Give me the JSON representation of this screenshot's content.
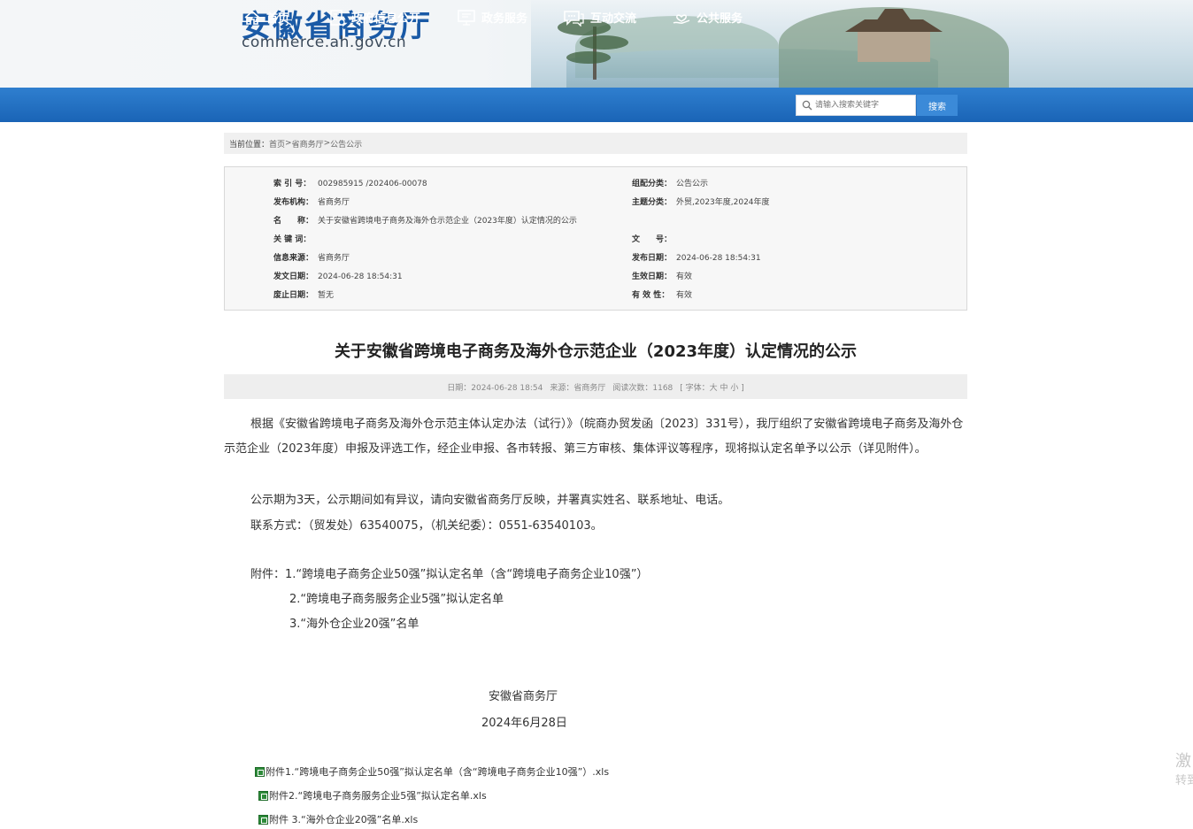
{
  "header": {
    "site_title": "安徽省商务厅",
    "site_domain": "commerce.ah.gov.cn"
  },
  "nav": {
    "items": [
      {
        "label": "首页",
        "icon": "home-icon"
      },
      {
        "label": "政府信息公开",
        "icon": "document-list-icon"
      },
      {
        "label": "政务服务",
        "icon": "monitor-icon"
      },
      {
        "label": "互动交流",
        "icon": "chat-icon"
      },
      {
        "label": "公共服务",
        "icon": "heart-hand-icon"
      }
    ],
    "search_placeholder": "请输入搜索关键字",
    "search_button": "搜索"
  },
  "breadcrumb": {
    "label": "当前位置：",
    "items": [
      "首页",
      "省商务厅",
      "公告公示"
    ],
    "separator": " > "
  },
  "meta": {
    "left": [
      {
        "key": "索 引 号：",
        "value": "002985915 /202406-00078"
      },
      {
        "key": "发布机构：",
        "value": "省商务厅"
      },
      {
        "key": "名　　称：",
        "value": "关于安徽省跨境电子商务及海外仓示范企业（2023年度）认定情况的公示"
      },
      {
        "key": "关 键 词：",
        "value": ""
      },
      {
        "key": "信息来源：",
        "value": "省商务厅"
      },
      {
        "key": "发文日期：",
        "value": "2024-06-28 18:54:31"
      },
      {
        "key": "废止日期：",
        "value": "暂无"
      }
    ],
    "right": [
      {
        "key": "组配分类：",
        "value": "公告公示"
      },
      {
        "key": "主题分类：",
        "value": "外贸,2023年度,2024年度"
      },
      {
        "key": "文　　号：",
        "value": ""
      },
      {
        "key": "发布日期：",
        "value": "2024-06-28 18:54:31"
      },
      {
        "key": "生效日期：",
        "value": "有效"
      },
      {
        "key": "有 效 性：",
        "value": "有效"
      }
    ]
  },
  "article": {
    "title": "关于安徽省跨境电子商务及海外仓示范企业（2023年度）认定情况的公示",
    "info": {
      "date": "日期：2024-06-28 18:54",
      "source": "来源：省商务厅",
      "views": "阅读次数：1168",
      "font_size": "[ 字体：大 中 小 ]"
    },
    "para1": "根据《安徽省跨境电子商务及海外仓示范主体认定办法（试行）》（皖商办贸发函〔2023〕331号），我厅组织了安徽省跨境电子商务及海外仓示范企业（2023年度）申报及评选工作，经企业申报、各市转报、第三方审核、集体评议等程序，现将拟认定名单予以公示（详见附件）。",
    "para2": "公示期为3天，公示期间如有异议，请向安徽省商务厅反映，并署真实姓名、联系地址、电话。",
    "para3": "联系方式：（贸发处）63540075，（机关纪委）：0551-63540103。",
    "attachments_intro": "附件：1.“跨境电子商务企业50强”拟认定名单（含“跨境电子商务企业10强”）",
    "attach_line2": "2.“跨境电子商务服务企业5强”拟认定名单",
    "attach_line3": "3.“海外仓企业20强”名单",
    "signature": "安徽省商务厅",
    "sign_date": "2024年6月28日",
    "files": [
      "附件1.“跨境电子商务企业50强”拟认定名单（含“跨境电子商务企业10强”）.xls",
      "附件2.“跨境电子商务服务企业5强”拟认定名单.xls",
      "附件  3.“海外仓企业20强”名单.xls"
    ]
  },
  "side": {
    "line1": "激",
    "line2": "转到"
  }
}
